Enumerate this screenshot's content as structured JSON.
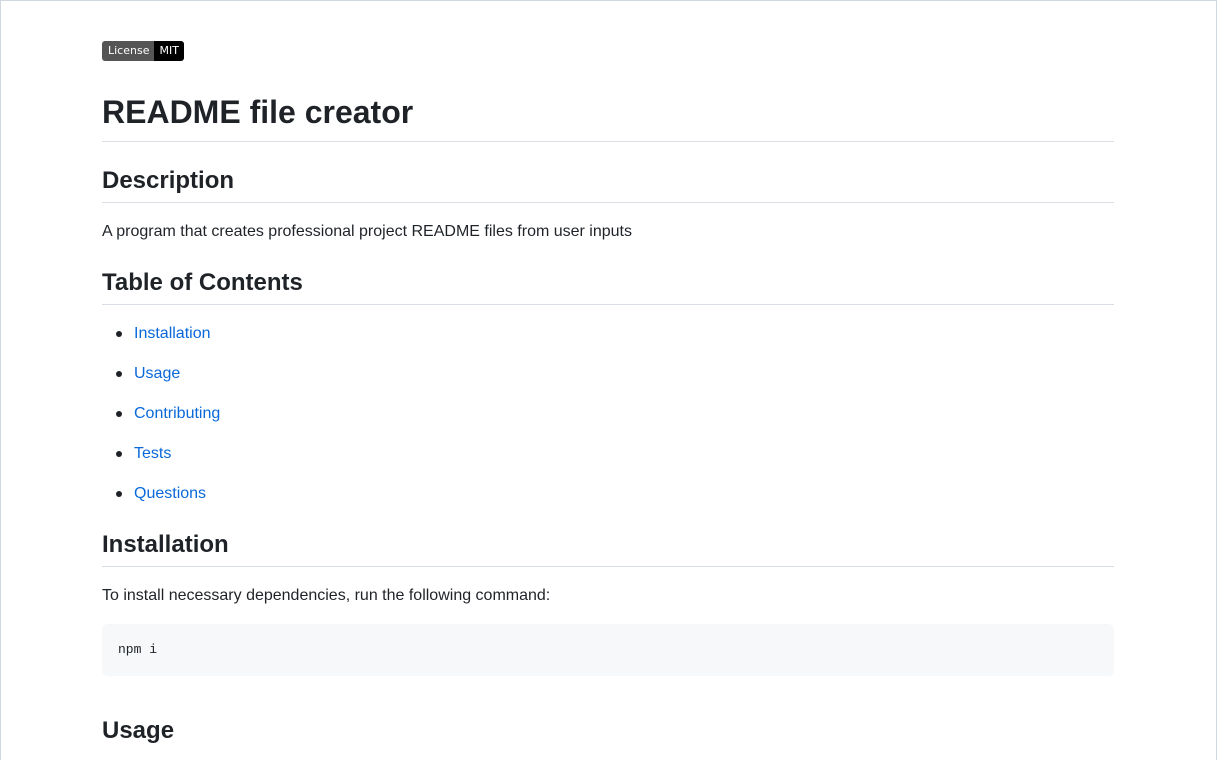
{
  "badge": {
    "label": "License",
    "value": "MIT"
  },
  "title": "README file creator",
  "description": {
    "heading": "Description",
    "text": "A program that creates professional project README files from user inputs"
  },
  "toc": {
    "heading": "Table of Contents",
    "items": [
      {
        "label": "Installation"
      },
      {
        "label": "Usage"
      },
      {
        "label": "Contributing"
      },
      {
        "label": "Tests"
      },
      {
        "label": "Questions"
      }
    ]
  },
  "installation": {
    "heading": "Installation",
    "text": "To install necessary dependencies, run the following command:",
    "code": "npm i"
  },
  "usage": {
    "heading": "Usage"
  },
  "colors": {
    "link": "#0969da",
    "text": "#1f2328",
    "badge_left": "#555555",
    "badge_right": "#000000",
    "code_bg": "#f6f8fa"
  }
}
